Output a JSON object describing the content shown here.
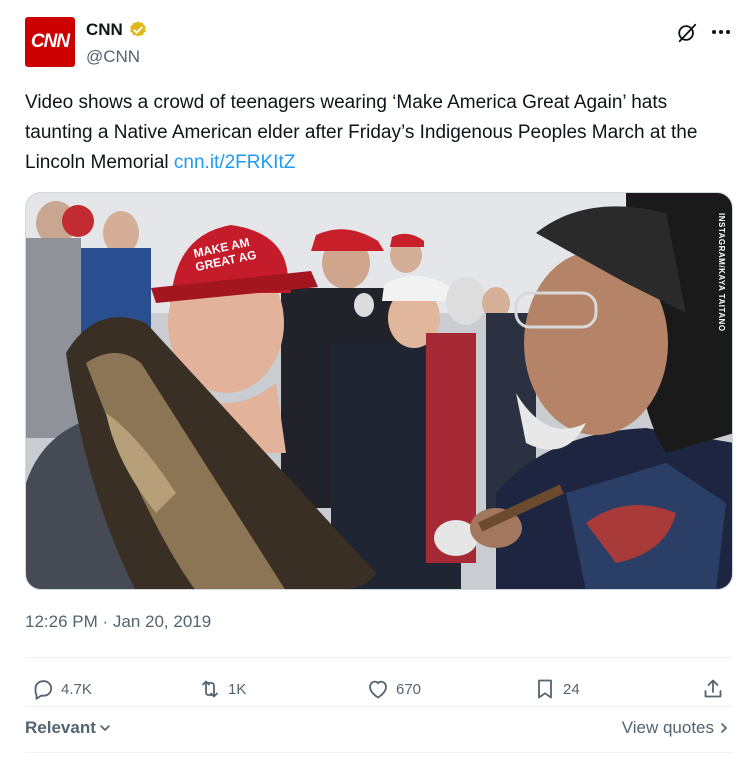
{
  "author": {
    "avatar_text": "CNN",
    "display_name": "CNN",
    "handle": "@CNN"
  },
  "tweet": {
    "text": "Video shows a crowd of teenagers wearing ‘Make America Great Again’ hats taunting a Native American elder after Friday’s Indigenous Peoples March at the Lincoln Memorial ",
    "link": "cnn.it/2FRKItZ",
    "media_credit": "INSTAGRAM/KAYA TAITANO",
    "hat_text_1": "MAKE AM",
    "hat_text_2": "GREAT AG",
    "timestamp": "12:26 PM · Jan 20, 2019"
  },
  "actions": {
    "replies": "4.7K",
    "reposts": "1K",
    "likes": "670",
    "bookmarks": "24"
  },
  "footer": {
    "sort_label": "Relevant",
    "view_quotes_label": "View quotes"
  },
  "colors": {
    "brand_red": "#cc0000",
    "link_blue": "#1d9bf0",
    "verified_gold": "#e2b719",
    "secondary_text": "#536471"
  }
}
